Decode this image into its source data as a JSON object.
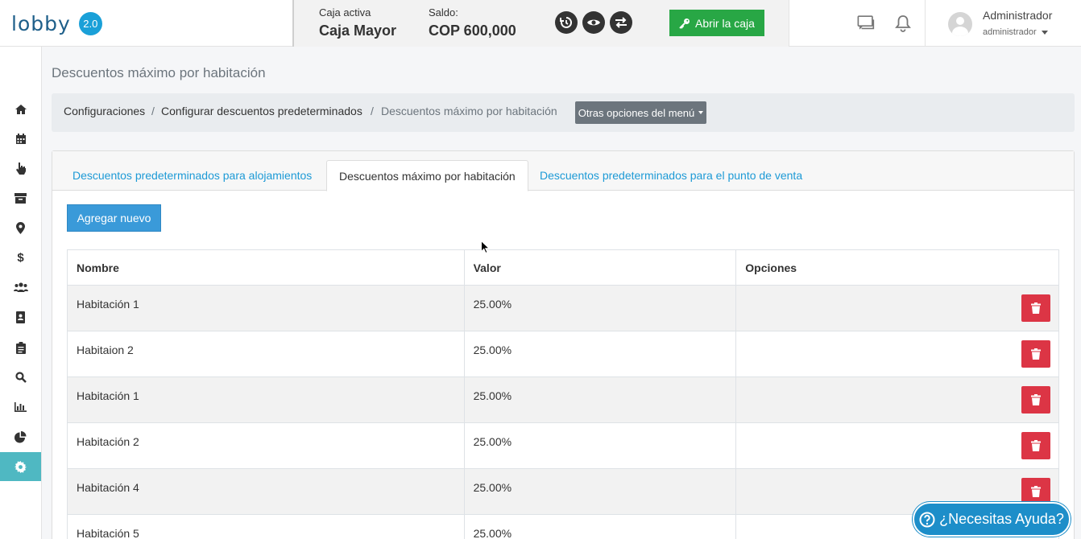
{
  "app": {
    "logo_text": "lobby",
    "version": "2.0"
  },
  "cashbox": {
    "active_label": "Caja activa",
    "active_value": "Caja Mayor",
    "balance_label": "Saldo:",
    "balance_value": "COP 600,000",
    "open_button": "Abrir la caja"
  },
  "user": {
    "name": "Administrador",
    "role": "administrador"
  },
  "page": {
    "title": "Descuentos máximo por habitación"
  },
  "breadcrumb": {
    "items": [
      "Configuraciones",
      "Configurar descuentos predeterminados",
      "Descuentos máximo por habitación"
    ],
    "separator": "/",
    "menu_button": "Otras opciones del menú"
  },
  "tabs": [
    {
      "label": "Descuentos predeterminados para alojamientos",
      "active": false
    },
    {
      "label": "Descuentos máximo por habitación",
      "active": true
    },
    {
      "label": "Descuentos predeterminados para el punto de venta",
      "active": false
    }
  ],
  "add_button": "Agregar nuevo",
  "table": {
    "headers": [
      "Nombre",
      "Valor",
      "Opciones"
    ],
    "rows": [
      {
        "name": "Habitación 1",
        "value": "25.00%"
      },
      {
        "name": "Habitaion 2",
        "value": "25.00%"
      },
      {
        "name": "Habitación 1",
        "value": "25.00%"
      },
      {
        "name": "Habitación 2",
        "value": "25.00%"
      },
      {
        "name": "Habitación 4",
        "value": "25.00%"
      },
      {
        "name": "Habitación 5",
        "value": "25.00%"
      }
    ]
  },
  "help_button": "¿Necesitas Ayuda?",
  "sidebar": {
    "items": [
      "home-icon",
      "calendar-icon",
      "hand-pointer-icon",
      "archive-icon",
      "map-marker-icon",
      "dollar-icon",
      "users-icon",
      "address-book-icon",
      "clipboard-icon",
      "search-icon",
      "bar-chart-icon",
      "pie-chart-icon",
      "gear-icon"
    ],
    "active_index": 12
  },
  "colors": {
    "accent": "#4fb8c2",
    "primary": "#3a9ad9",
    "success": "#28a745",
    "danger": "#dc3545"
  }
}
